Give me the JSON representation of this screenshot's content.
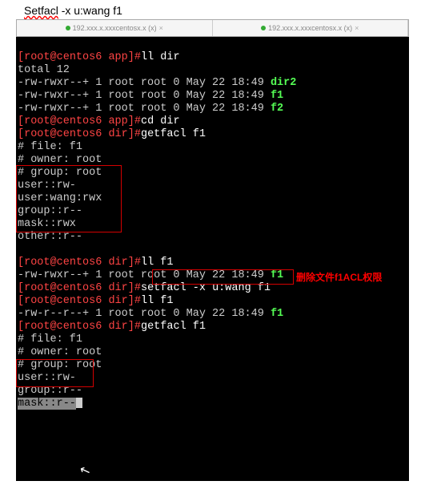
{
  "header": {
    "command": "Setfacl  -x  u:wang f1"
  },
  "tabs": {
    "left": "192.xxx.x.xxxcentosx.x (x)",
    "right": "192.xxx.x.xxxcentosx.x (x)"
  },
  "prompt": {
    "open": "[",
    "user": "root",
    "at": "@",
    "host": "centos6",
    "path_app": " app",
    "path_dir": " dir",
    "close": "]",
    "hash": "#"
  },
  "lines": {
    "c1": "ll dir",
    "total": "total 12",
    "row1a": "-rw-rwxr--+ 1 root root 0 May 22 18:49 ",
    "row1b": "dir2",
    "row2a": "-rw-rwxr--+ 1 root root 0 May 22 18:49 ",
    "row2b": "f1",
    "row3a": "-rw-rwxr--+ 1 root root 0 May 22 18:49 ",
    "row3b": "f2",
    "c2": "cd dir",
    "c3": "getfacl f1",
    "file": "# file: f1",
    "owner": "# owner: root",
    "group": "# group: root",
    "u1": "user::rw-",
    "u2": "user:wang:rwx",
    "g1": "group::r--",
    "m1": "mask::rwx",
    "o1": "other::r--",
    "c4": "ll f1",
    "row4a": "-rw-rwxr--+ 1 root root 0 May 22 18:49 ",
    "row4b": "f1",
    "c5": "setfacl -x u:wang f1",
    "c6": "ll f1",
    "row5a": "-rw-r--r--+ 1 root root 0 May 22 18:49 ",
    "row5b": "f1",
    "c7": "getfacl f1",
    "file2": "# file: f1",
    "owner2": "# owner: root",
    "group2": "# group: root",
    "u3": "user::rw-",
    "g2": "group::r--",
    "m2": "mask::r--",
    "annotation": "删除文件f1ACL权限"
  }
}
